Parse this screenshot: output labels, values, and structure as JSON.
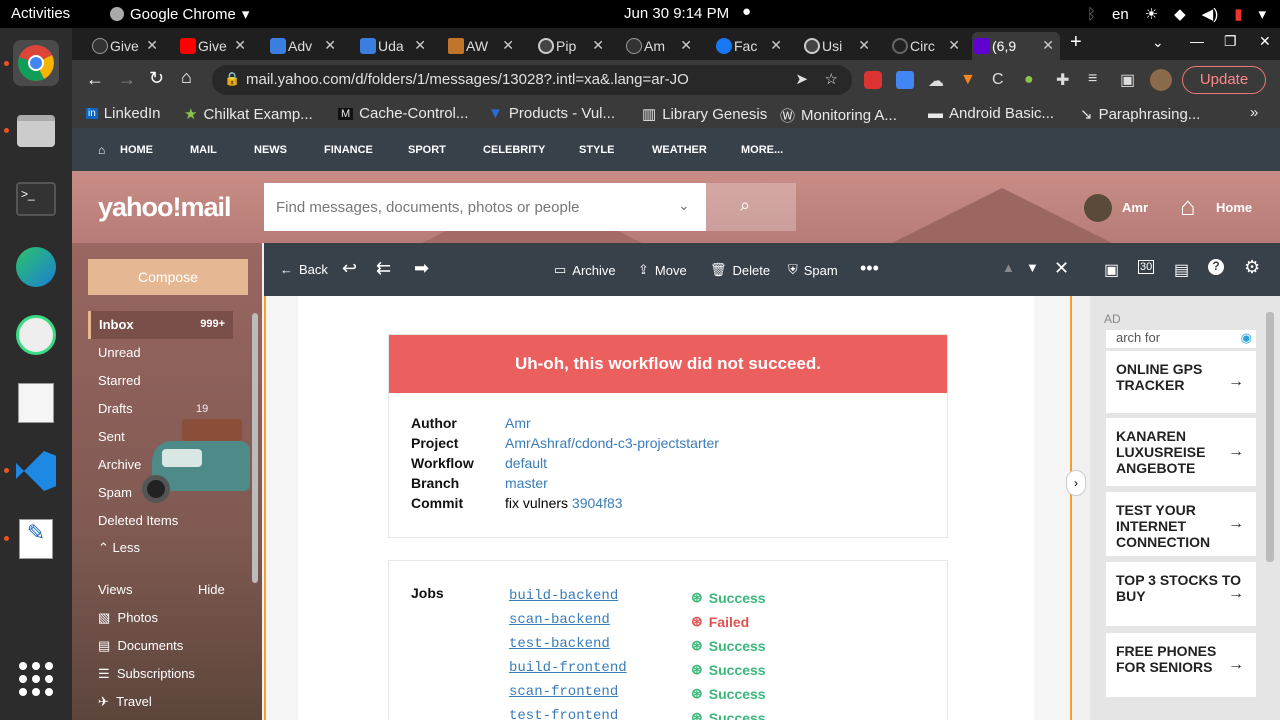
{
  "os": {
    "activities": "Activities",
    "app_name": "Google Chrome",
    "clock": "Jun 30  9:14 PM",
    "lang": "en"
  },
  "tabs": [
    {
      "title": "Give",
      "color": "#333"
    },
    {
      "title": "Give",
      "color": "#ff0000"
    },
    {
      "title": "Adv",
      "color": "#3a7ee0"
    },
    {
      "title": "Uda",
      "color": "#3a7ee0"
    },
    {
      "title": "AW",
      "color": "#c0752a"
    },
    {
      "title": "Pip",
      "color": "#555"
    },
    {
      "title": "Am",
      "color": "#333"
    },
    {
      "title": "Fac",
      "color": "#1877f2"
    },
    {
      "title": "Usi",
      "color": "#555"
    },
    {
      "title": "Circ",
      "color": "#222"
    },
    {
      "title": "(6,9",
      "color": "#6001d2"
    }
  ],
  "url": "mail.yahoo.com/d/folders/1/messages/13028?.intl=xa&.lang=ar-JO",
  "update_label": "Update",
  "bookmarks": [
    "LinkedIn",
    "Chilkat Examp...",
    "Cache-Control...",
    "Products - Vul...",
    "Library Genesis",
    "Monitoring A...",
    "Android Basic...",
    "Paraphrasing..."
  ],
  "ynav": [
    "HOME",
    "MAIL",
    "NEWS",
    "FINANCE",
    "SPORT",
    "CELEBRITY",
    "STYLE",
    "WEATHER",
    "MORE..."
  ],
  "logo": "yahoo!mail",
  "search_placeholder": "Find messages, documents, photos or people",
  "user": "Amr",
  "home_label": "Home",
  "compose": "Compose",
  "folders": {
    "inbox": "Inbox",
    "inbox_count": "999+",
    "unread": "Unread",
    "starred": "Starred",
    "drafts": "Drafts",
    "drafts_count": "19",
    "sent": "Sent",
    "archive": "Archive",
    "spam": "Spam",
    "deleted": "Deleted Items",
    "less": "Less",
    "views": "Views",
    "hide": "Hide",
    "photos": "Photos",
    "documents": "Documents",
    "subscriptions": "Subscriptions",
    "travel": "Travel"
  },
  "mail_toolbar": {
    "back": "Back",
    "archive": "Archive",
    "move": "Move",
    "delete": "Delete",
    "spam": "Spam"
  },
  "email": {
    "banner": "Uh-oh, this workflow did not succeed.",
    "author_k": "Author",
    "author": "Amr",
    "project_k": "Project",
    "project": "AmrAshraf/cdond-c3-projectstarter",
    "workflow_k": "Workflow",
    "workflow": "default",
    "branch_k": "Branch",
    "branch": "master",
    "commit_k": "Commit",
    "commit_msg": "fix vulners",
    "commit_hash": "3904f83",
    "jobs_k": "Jobs",
    "jobs": [
      {
        "name": "build-backend",
        "status": "Success"
      },
      {
        "name": "scan-backend",
        "status": "Failed"
      },
      {
        "name": "test-backend",
        "status": "Success"
      },
      {
        "name": "build-frontend",
        "status": "Success"
      },
      {
        "name": "scan-frontend",
        "status": "Success"
      },
      {
        "name": "test-frontend",
        "status": "Success"
      }
    ]
  },
  "ads": {
    "ad_label": "AD",
    "search_for": "arch for",
    "items": [
      "ONLINE GPS TRACKER",
      "KANAREN LUXUSREISE ANGEBOTE",
      "TEST YOUR INTERNET CONNECTION",
      "TOP 3 STOCKS TO BUY",
      "FREE PHONES FOR SENIORS"
    ]
  },
  "colors": {
    "success": "#3ab87a",
    "failed": "#e05252",
    "banner": "#ec5f5f",
    "link": "#3a7cb8"
  }
}
